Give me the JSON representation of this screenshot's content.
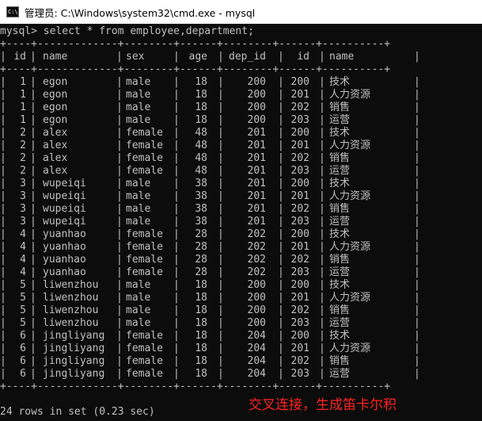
{
  "window": {
    "title": "管理员: C:\\Windows\\system32\\cmd.exe - mysql",
    "icon": "cmd-prompt-icon",
    "icon_glyph": "C:\\"
  },
  "console": {
    "command": "mysql> select * from employee,department;",
    "border": "+----+-------------+--------+------+--------+------+----------+",
    "headers": [
      "id",
      "name",
      "sex",
      "age",
      "dep_id",
      "id",
      "name"
    ],
    "rows": [
      [
        "1",
        "egon",
        "male",
        "18",
        "200",
        "200",
        "技术"
      ],
      [
        "1",
        "egon",
        "male",
        "18",
        "200",
        "201",
        "人力资源"
      ],
      [
        "1",
        "egon",
        "male",
        "18",
        "200",
        "202",
        "销售"
      ],
      [
        "1",
        "egon",
        "male",
        "18",
        "200",
        "203",
        "运营"
      ],
      [
        "2",
        "alex",
        "female",
        "48",
        "201",
        "200",
        "技术"
      ],
      [
        "2",
        "alex",
        "female",
        "48",
        "201",
        "201",
        "人力资源"
      ],
      [
        "2",
        "alex",
        "female",
        "48",
        "201",
        "202",
        "销售"
      ],
      [
        "2",
        "alex",
        "female",
        "48",
        "201",
        "203",
        "运营"
      ],
      [
        "3",
        "wupeiqi",
        "male",
        "38",
        "201",
        "200",
        "技术"
      ],
      [
        "3",
        "wupeiqi",
        "male",
        "38",
        "201",
        "201",
        "人力资源"
      ],
      [
        "3",
        "wupeiqi",
        "male",
        "38",
        "201",
        "202",
        "销售"
      ],
      [
        "3",
        "wupeiqi",
        "male",
        "38",
        "201",
        "203",
        "运营"
      ],
      [
        "4",
        "yuanhao",
        "female",
        "28",
        "202",
        "200",
        "技术"
      ],
      [
        "4",
        "yuanhao",
        "female",
        "28",
        "202",
        "201",
        "人力资源"
      ],
      [
        "4",
        "yuanhao",
        "female",
        "28",
        "202",
        "202",
        "销售"
      ],
      [
        "4",
        "yuanhao",
        "female",
        "28",
        "202",
        "203",
        "运营"
      ],
      [
        "5",
        "liwenzhou",
        "male",
        "18",
        "200",
        "200",
        "技术"
      ],
      [
        "5",
        "liwenzhou",
        "male",
        "18",
        "200",
        "201",
        "人力资源"
      ],
      [
        "5",
        "liwenzhou",
        "male",
        "18",
        "200",
        "202",
        "销售"
      ],
      [
        "5",
        "liwenzhou",
        "male",
        "18",
        "200",
        "203",
        "运营"
      ],
      [
        "6",
        "jingliyang",
        "female",
        "18",
        "204",
        "200",
        "技术"
      ],
      [
        "6",
        "jingliyang",
        "female",
        "18",
        "204",
        "201",
        "人力资源"
      ],
      [
        "6",
        "jingliyang",
        "female",
        "18",
        "204",
        "202",
        "销售"
      ],
      [
        "6",
        "jingliyang",
        "female",
        "18",
        "204",
        "203",
        "运营"
      ]
    ],
    "result_summary": "24 rows in set (0.23 sec)"
  },
  "annotation": {
    "text": "交叉连接，生成笛卡尔积",
    "color": "#ff2222"
  },
  "colors": {
    "console_bg": "#0c0c0c",
    "console_text": "#c0c0c0",
    "titlebar_bg": "#ffffff"
  }
}
